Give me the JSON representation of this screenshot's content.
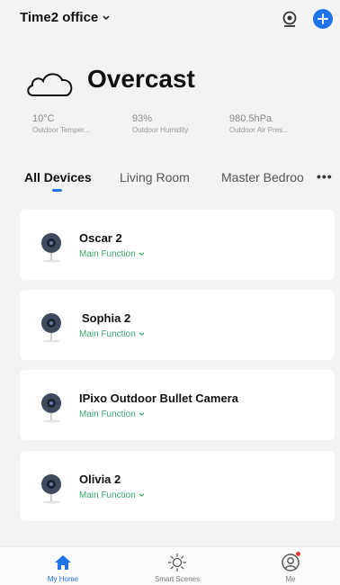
{
  "header": {
    "home_name": "Time2 office"
  },
  "weather": {
    "condition": "Overcast",
    "stats": [
      {
        "value": "10°C",
        "label": "Outdoor Temper..."
      },
      {
        "value": "93%",
        "label": "Outdoor Humidity"
      },
      {
        "value": "980.5hPa",
        "label": "Outdoor Air Pres..."
      }
    ]
  },
  "tabs": [
    "All Devices",
    "Living Room",
    "Master Bedroo"
  ],
  "devices": [
    {
      "name": "Oscar 2",
      "function": "Main Function"
    },
    {
      "name": "Sophia 2",
      "function": "Main Function"
    },
    {
      "name": "IPixo Outdoor Bullet Camera",
      "function": "Main Function"
    },
    {
      "name": "Olivia 2",
      "function": "Main Function"
    }
  ],
  "nav": [
    {
      "label": "My Home"
    },
    {
      "label": "Smart Scenes"
    },
    {
      "label": "Me"
    }
  ],
  "colors": {
    "accent": "#1e73e8",
    "function_text": "#3aa56b",
    "badge": "#e53935"
  }
}
